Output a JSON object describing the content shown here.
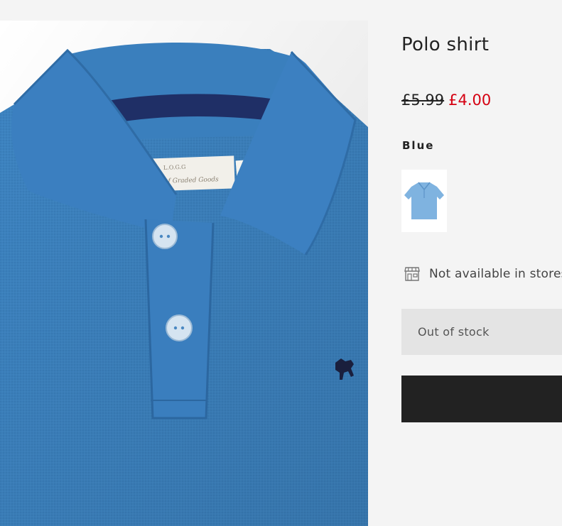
{
  "product": {
    "title": "Polo shirt",
    "price_original": "£5.99",
    "price_sale": "£4.00",
    "color_name": "Blue",
    "store_availability": "Not available in stores",
    "size_select_text": "Out of stock",
    "add_to_bag_label": ""
  },
  "icons": {
    "store": "store-icon"
  },
  "colors": {
    "sale_price": "#d50011",
    "shirt": "#3d84c2",
    "button": "#222222"
  }
}
